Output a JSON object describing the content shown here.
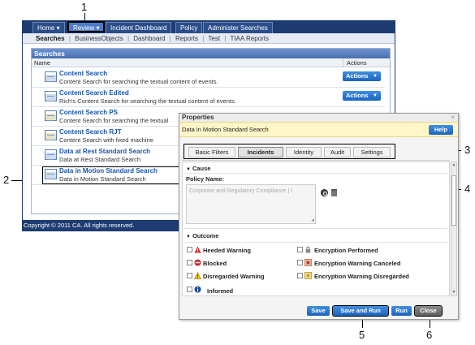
{
  "callouts": {
    "c1": "1",
    "c2": "2",
    "c3": "3",
    "c4": "4",
    "c5": "5",
    "c6": "6"
  },
  "topnav": {
    "tabs": [
      "Home ▾",
      "Review ▾",
      "Incident Dashboard",
      "Policy",
      "Administer Searches"
    ]
  },
  "subnav": {
    "items": [
      "Searches",
      "BusinessObjects",
      "Dashboard",
      "Reports",
      "Test",
      "TIAA Reports"
    ],
    "separator": "|"
  },
  "searches": {
    "header": "Searches",
    "col_name": "Name",
    "col_actions": "Actions",
    "action_label": "Actions",
    "rows": [
      {
        "title": "Content Search",
        "desc": "Content Search for searching the textual content of events."
      },
      {
        "title": "Content Search Edited",
        "desc": "Rich's Content Search for searching the textual content of events."
      },
      {
        "title": "Content Search PS",
        "desc": "Content Search for searching the textual"
      },
      {
        "title": "Content Search RJT",
        "desc": "Content Search with fixed machine"
      },
      {
        "title": "Data at Rest Standard Search",
        "desc": "Data at Rest Standard Search"
      },
      {
        "title": "Data in Motion Standard Search",
        "desc": "Data in Motion Standard Search"
      }
    ]
  },
  "footer": "Copyright © 2011 CA. All rights reserved.",
  "props": {
    "title": "Properties",
    "close_x": "×",
    "search_name": "Data in Motion Standard Search",
    "help": "Help",
    "tabs": [
      "Basic Filters",
      "Incidents",
      "Identity",
      "Audit",
      "Settings"
    ],
    "cause": "Cause",
    "policy_label": "Policy Name:",
    "policy_value": "Corporate and Regulatory Compliance | I",
    "outcome": "Outcome",
    "outcomes_left": [
      "Heeded Warning",
      "Blocked",
      "Disregarded Warning",
      "Informed"
    ],
    "outcomes_right": [
      "Encryption Performed",
      "Encryption Warning Canceled",
      "Encryption Warning Disregarded"
    ],
    "buttons": {
      "save": "Save",
      "save_run": "Save and Run",
      "run": "Run",
      "close": "Close"
    }
  }
}
